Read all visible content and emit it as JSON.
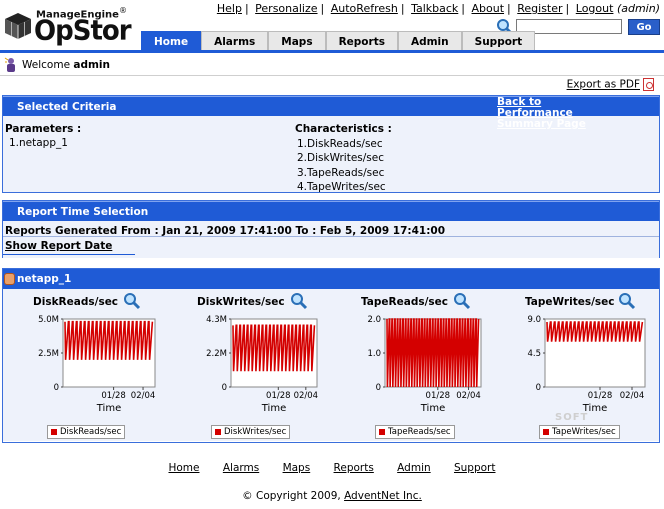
{
  "brand": {
    "maker": "ManageEngine",
    "registered": "®",
    "product": "OpStor"
  },
  "top_links": [
    {
      "label": "Help"
    },
    {
      "label": "Personalize"
    },
    {
      "label": "AutoRefresh"
    },
    {
      "label": "Talkback"
    },
    {
      "label": "About"
    },
    {
      "label": "Register"
    },
    {
      "label": "Logout"
    }
  ],
  "top_user": "(admin)",
  "search": {
    "value": "",
    "button": "Go"
  },
  "tabs": [
    {
      "label": "Home",
      "active": true
    },
    {
      "label": "Alarms"
    },
    {
      "label": "Maps"
    },
    {
      "label": "Reports"
    },
    {
      "label": "Admin"
    },
    {
      "label": "Support"
    }
  ],
  "welcome": {
    "prefix": "Welcome",
    "user": "admin"
  },
  "export_label": "Export as PDF",
  "criteria": {
    "title": "Selected Criteria",
    "back_link": "Back to Performance Summary Page",
    "params_label": "Parameters :",
    "params": [
      "1.netapp_1"
    ],
    "chars_label": "Characteristics :",
    "chars": [
      "1.DiskReads/sec",
      "2.DiskWrites/sec",
      "3.TapeReads/sec",
      "4.TapeWrites/sec"
    ]
  },
  "time_selection": {
    "title": "Report Time Selection",
    "generated": "Reports Generated From : Jan 21, 2009 17:41:00 To : Feb 5, 2009 17:41:00",
    "show_date": "Show Report Date"
  },
  "device": {
    "name": "netapp_1"
  },
  "chart_data": [
    {
      "type": "line",
      "title": "DiskReads/sec",
      "ylabel": "",
      "xlabel": "Time",
      "y_ticks": [
        "5.0M",
        "2.5M",
        "0"
      ],
      "x_ticks": [
        "01/28",
        "02/04"
      ],
      "ylim": [
        0,
        5000000
      ],
      "series": [
        {
          "name": "DiskReads/sec",
          "color": "#d40000",
          "low": 2000000,
          "high": 4800000,
          "cycles": 22
        }
      ]
    },
    {
      "type": "line",
      "title": "DiskWrites/sec",
      "ylabel": "",
      "xlabel": "Time",
      "y_ticks": [
        "4.3M",
        "2.2M",
        "0"
      ],
      "x_ticks": [
        "01/28",
        "02/04"
      ],
      "ylim": [
        0,
        4300000
      ],
      "series": [
        {
          "name": "DiskWrites/sec",
          "color": "#d40000",
          "low": 1000000,
          "high": 3900000,
          "cycles": 22
        }
      ]
    },
    {
      "type": "line",
      "title": "TapeReads/sec",
      "ylabel": "",
      "xlabel": "Time",
      "y_ticks": [
        "2.0",
        "1.0",
        "0"
      ],
      "x_ticks": [
        "01/28",
        "02/04"
      ],
      "ylim": [
        0,
        2
      ],
      "series": [
        {
          "name": "TapeReads/sec",
          "color": "#d40000",
          "low": 0.0,
          "high": 2.0,
          "cycles": 34
        }
      ]
    },
    {
      "type": "line",
      "title": "TapeWrites/sec",
      "ylabel": "",
      "xlabel": "Time",
      "y_ticks": [
        "9.0",
        "4.5",
        "0"
      ],
      "x_ticks": [
        "01/28",
        "02/04"
      ],
      "ylim": [
        0,
        9
      ],
      "series": [
        {
          "name": "TapeWrites/sec",
          "color": "#d40000",
          "low": 6.0,
          "high": 8.6,
          "cycles": 24
        }
      ]
    }
  ],
  "footer_links": [
    {
      "label": "Home"
    },
    {
      "label": "Alarms"
    },
    {
      "label": "Maps"
    },
    {
      "label": "Reports"
    },
    {
      "label": "Admin"
    },
    {
      "label": "Support"
    }
  ],
  "copyright": {
    "prefix": "© Copyright 2009,",
    "company": "AdventNet Inc."
  },
  "watermark": "SOFT"
}
